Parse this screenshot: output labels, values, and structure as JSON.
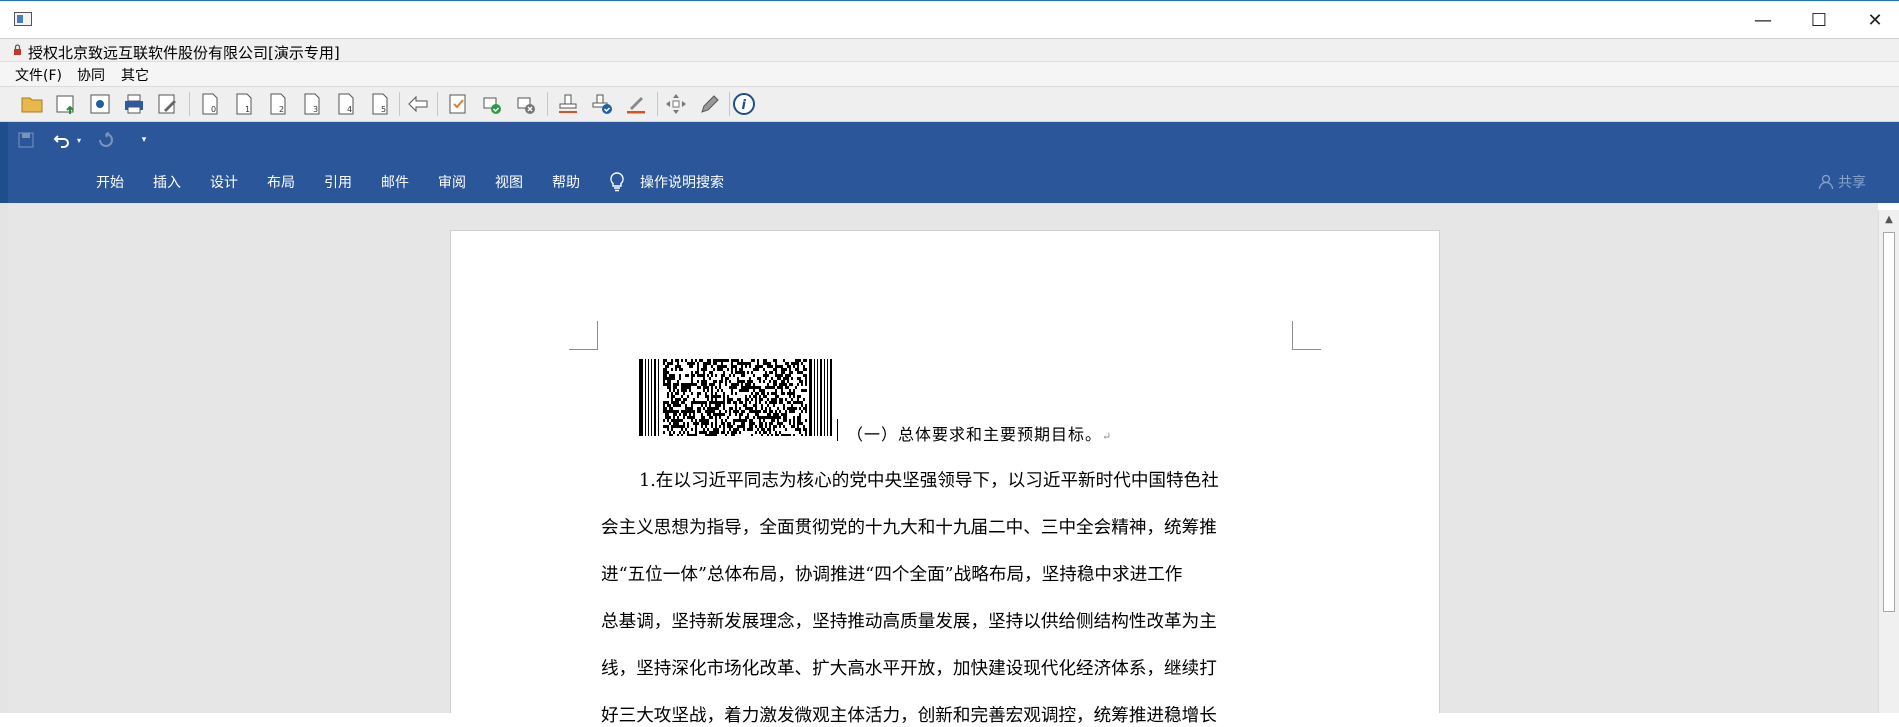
{
  "window": {
    "minimize_glyph": "—",
    "maximize_glyph": "☐",
    "close_glyph": "✕"
  },
  "license_text": "授权北京致远互联软件股份有限公司[演示专用]",
  "menu": [
    "文件(F)",
    "协同",
    "其它"
  ],
  "toolbar_icons": [
    "open-folder-icon",
    "save-upload-icon",
    "settings-icon",
    "print-icon",
    "edit-doc-icon",
    "doc-0-icon",
    "doc-1-icon",
    "doc-2-icon",
    "doc-3-icon",
    "doc-4-icon",
    "doc-5-icon",
    "back-arrow-icon",
    "check-doc-icon",
    "approve-icon",
    "reject-icon",
    "stamp-icon",
    "signature-icon",
    "handwrite-icon",
    "move-icon",
    "pen-icon",
    "info-icon"
  ],
  "ribbon": {
    "tabs": [
      "开始",
      "插入",
      "设计",
      "布局",
      "引用",
      "邮件",
      "审阅",
      "视图",
      "帮助"
    ],
    "search_label": "操作说明搜索",
    "share_label": "共享"
  },
  "document": {
    "heading": "（一）总体要求和主要预期目标。",
    "paragraph_mark": "↵",
    "lines": [
      "1.在以习近平同志为核心的党中央坚强领导下，以习近平新时代中国特色社",
      "会主义思想为指导，全面贯彻党的十九大和十九届二中、三中全会精神，统筹推",
      "进“五位一体”总体布局，协调推进“四个全面”战略布局，坚持稳中求进工作",
      "总基调，坚持新发展理念，坚持推动高质量发展，坚持以供给侧结构性改革为主",
      "线，坚持深化市场化改革、扩大高水平开放，加快建设现代化经济体系，继续打",
      "好三大攻坚战，着力激发微观主体活力，创新和完善宏观调控，统筹推进稳增长"
    ]
  },
  "colors": {
    "ribbon": "#2b579a",
    "workspace": "#e6e6e6"
  }
}
